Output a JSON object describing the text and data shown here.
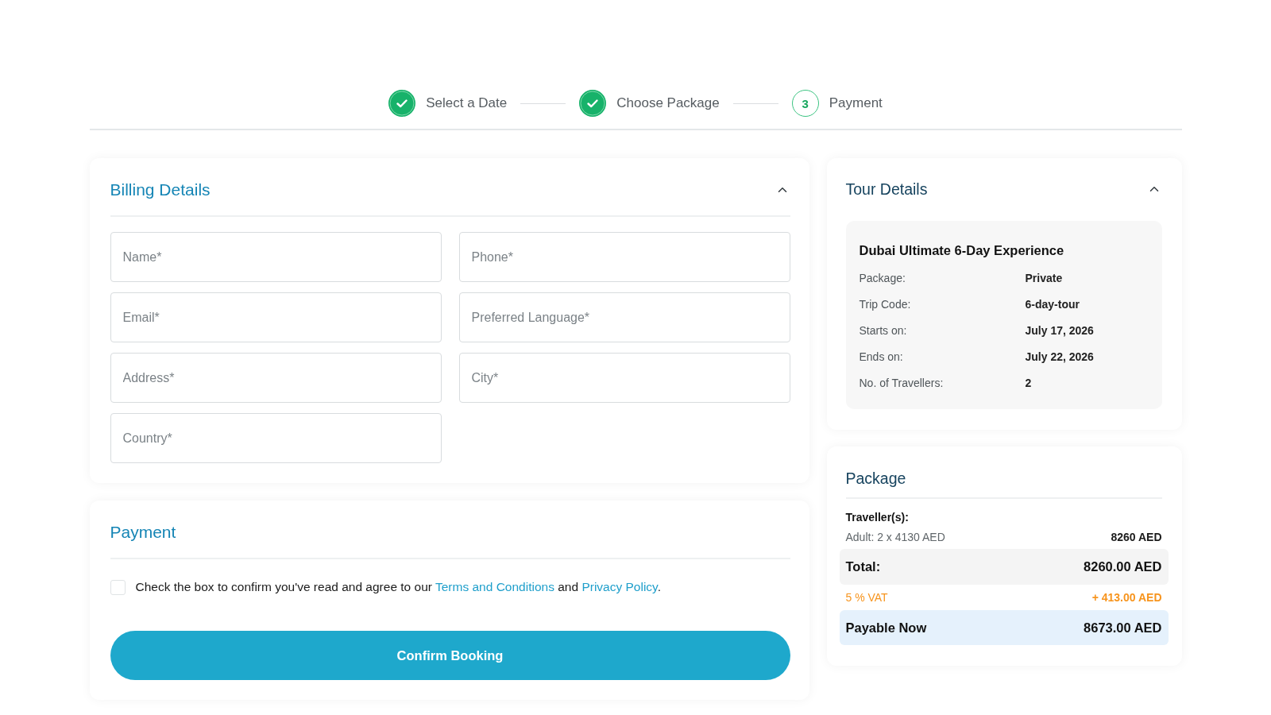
{
  "stepper": {
    "steps": [
      {
        "label": "Select a Date",
        "completed": true
      },
      {
        "label": "Choose Package",
        "completed": true
      },
      {
        "label": "Payment",
        "completed": false,
        "number": "3"
      }
    ]
  },
  "billing": {
    "title": "Billing Details",
    "expanded": true,
    "fields": [
      {
        "placeholder": "Name*"
      },
      {
        "placeholder": "Phone*"
      },
      {
        "placeholder": "Email*"
      },
      {
        "placeholder": "Preferred Language*"
      },
      {
        "placeholder": "Address*"
      },
      {
        "placeholder": "City*"
      },
      {
        "placeholder": "Country*"
      }
    ]
  },
  "payment": {
    "title": "Payment",
    "agreement": {
      "checked": false,
      "before": "Check the box to confirm you've read and agree to our",
      "terms_link": "Terms and Conditions",
      "middle": "and",
      "privacy_link": "Privacy Policy",
      "after": "."
    },
    "confirm_button": "Confirm Booking"
  },
  "tour_details": {
    "title": "Tour Details",
    "expanded": true,
    "tour_name": "Dubai Ultimate 6-Day Experience",
    "rows": [
      {
        "label": "Package:",
        "value": "Private"
      },
      {
        "label": "Trip Code:",
        "value": "6-day-tour"
      },
      {
        "label": "Starts on:",
        "value": "July 17, 2026"
      },
      {
        "label": "Ends on:",
        "value": "July 22, 2026"
      },
      {
        "label": "No. of Travellers:",
        "value": "2"
      }
    ]
  },
  "package": {
    "title": "Package",
    "travellers_heading": "Traveller(s):",
    "lines": [
      {
        "label": "Adult: 2 x 4130 AED",
        "amount": "8260 AED"
      }
    ],
    "summary": [
      {
        "kind": "total",
        "label": "Total:",
        "amount": "8260.00 AED"
      },
      {
        "kind": "tax",
        "label": "5 % VAT",
        "amount": "+ 413.00 AED"
      },
      {
        "kind": "payable",
        "label": "Payable Now",
        "amount": "8673.00 AED"
      }
    ]
  }
}
